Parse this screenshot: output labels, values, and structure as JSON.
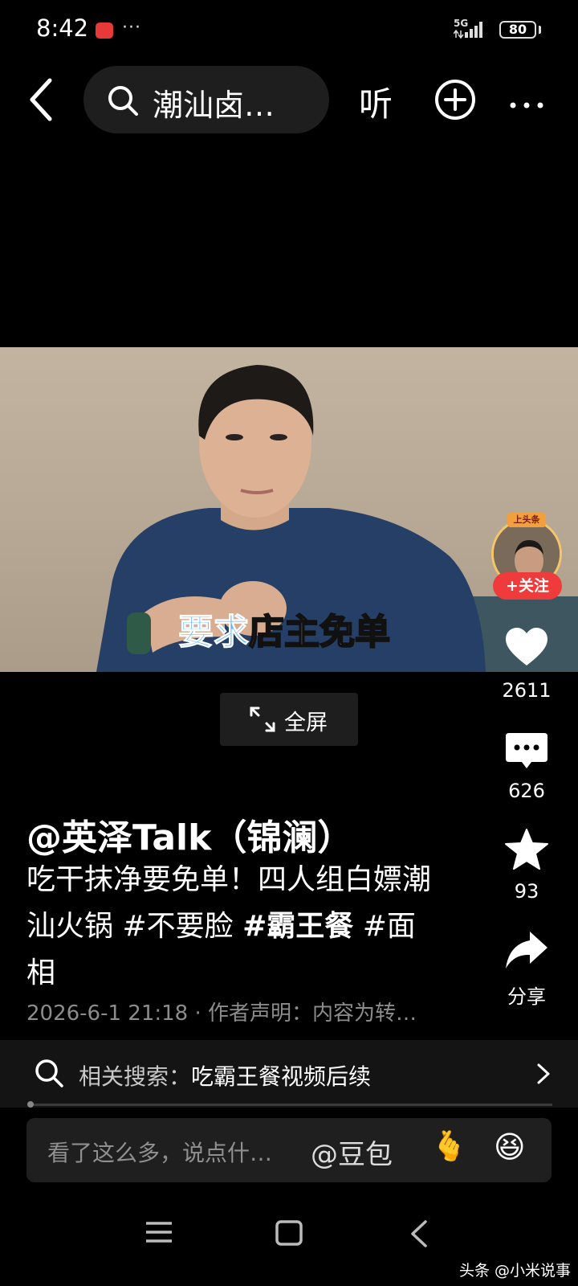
{
  "status_bar": {
    "time": "8:42",
    "more": "···",
    "network": "5G",
    "battery": "80"
  },
  "top_bar": {
    "search_text": "潮汕卤…",
    "listen_label": "听"
  },
  "video": {
    "subtitle_part1": "要求",
    "subtitle_part2": "店主免单"
  },
  "author": {
    "avatar_tag": "上头条",
    "follow_label": "+关注",
    "name": "@英泽Talk（锦澜）"
  },
  "actions": {
    "likes": "2611",
    "comments": "626",
    "favorites": "93",
    "share_label": "分享"
  },
  "fullscreen_label": "全屏",
  "caption": {
    "text": "吃干抹净要免单！四人组白嫖潮汕火锅",
    "tag1": "#不要脸",
    "tag2": "#霸王餐",
    "tag3": "#面相"
  },
  "meta": {
    "datetime": "2026-6-1 21:18",
    "separator": "·",
    "statement": "作者声明：内容为转…"
  },
  "related_search": {
    "label": "相关搜索：",
    "term": "吃霸王餐视频后续"
  },
  "comment_input": {
    "placeholder": "看了这么多，说点什…",
    "mention": "@豆包",
    "emoji_heart": "🫰",
    "emoji_laugh": "😆"
  },
  "watermark": "头条 @小米说事",
  "colors": {
    "follow": "#ef3b3b",
    "subtitle_blue": "#5fb4ff",
    "background": "#000000"
  }
}
